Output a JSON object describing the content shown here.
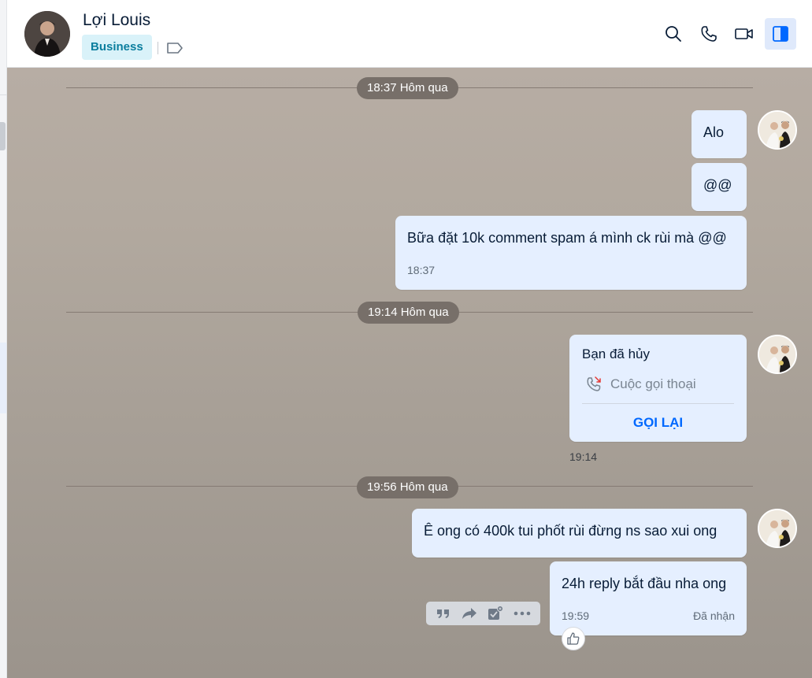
{
  "contact": {
    "name": "Lợi Louis",
    "badge": "Business"
  },
  "header": {
    "icons": [
      "search-icon",
      "phone-icon",
      "video-call-icon",
      "toggle-panel-icon"
    ]
  },
  "dividers": [
    {
      "label": "18:37 Hôm qua"
    },
    {
      "label": "19:14 Hôm qua"
    },
    {
      "label": "19:56 Hôm qua"
    }
  ],
  "messages": {
    "m1": {
      "text": "Alo"
    },
    "m2": {
      "text": "@@"
    },
    "m3": {
      "text": "Bữa đặt 10k comment spam á mình ck rùi mà @@",
      "time": "18:37"
    },
    "call": {
      "title": "Bạn đã hủy",
      "type": "Cuộc gọi thoại",
      "action": "GỌI LẠI",
      "time": "19:14"
    },
    "m4": {
      "text": "Ê ong có 400k tui phốt rùi đừng ns sao xui ong"
    },
    "m5": {
      "text": "24h reply bắt đầu nha ong",
      "time": "19:59",
      "status": "Đã nhận"
    }
  },
  "toolbar_icons": [
    "quote-icon",
    "forward-icon",
    "add-task-icon",
    "more-icon"
  ],
  "colors": {
    "accent": "#0068ff",
    "bubble": "#e5efff",
    "badge_bg": "#d9f2f9",
    "badge_text": "#0b7e9e"
  }
}
